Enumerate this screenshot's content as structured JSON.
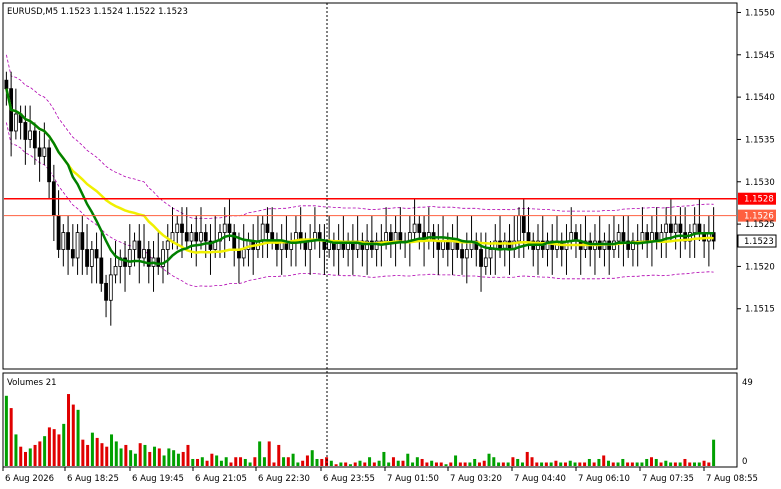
{
  "header": {
    "symbol_line": "EURUSD,M5  1.1523 1.1524 1.1522 1.1523"
  },
  "volume_panel": {
    "label": "Volumes 21",
    "top_tick": "49",
    "bottom_tick": "0"
  },
  "colors": {
    "up_volume": "#00a000",
    "down_volume": "#e00000",
    "ma_fast": "#008000",
    "ma_slow": "#f0f000",
    "envelope": "#b000b0",
    "level_line": "#ff0000",
    "level_line_light": "#ff6040",
    "candle": "#000000",
    "badge_text": "#ffffff",
    "current_badge_text": "#000000"
  },
  "chart_data": {
    "type": "candlestick",
    "symbol": "EURUSD",
    "timeframe": "M5",
    "ohlc_label": {
      "open": 1.1523,
      "high": 1.1524,
      "low": 1.1522,
      "close": 1.1523
    },
    "y_range": [
      1.1508,
      1.1551
    ],
    "y_ticks": [
      "1.1550",
      "1.1545",
      "1.1540",
      "1.1535",
      "1.1530",
      "1.1525",
      "1.1520",
      "1.1515"
    ],
    "x_ticks": [
      "6 Aug 2026",
      "6 Aug 18:25",
      "6 Aug 19:45",
      "6 Aug 21:05",
      "6 Aug 22:30",
      "6 Aug 23:55",
      "7 Aug 01:50",
      "7 Aug 03:20",
      "7 Aug 04:40",
      "7 Aug 06:10",
      "7 Aug 07:35",
      "7 Aug 08:55"
    ],
    "levels": [
      {
        "value": 1.1528,
        "label": "1.1528",
        "style": "solid"
      },
      {
        "value": 1.1526,
        "label": "1.1526",
        "style": "light"
      }
    ],
    "current_price": {
      "value": 1.1523,
      "label": "1.1523"
    },
    "vertical_marker_after_tick": "6 Aug 23:55",
    "closes": [
      1.1541,
      1.1536,
      1.1538,
      1.1537,
      1.1535,
      1.1536,
      1.1534,
      1.1533,
      1.1534,
      1.153,
      1.1526,
      1.1522,
      1.1524,
      1.1522,
      1.1521,
      1.1524,
      1.1522,
      1.152,
      1.1522,
      1.1521,
      1.1518,
      1.1516,
      1.1519,
      1.152,
      1.1521,
      1.152,
      1.1522,
      1.1523,
      1.1521,
      1.1522,
      1.152,
      1.1521,
      1.152,
      1.1522,
      1.1523,
      1.1524,
      1.1525,
      1.1524,
      1.1523,
      1.1524,
      1.1523,
      1.1524,
      1.1523,
      1.1522,
      1.1523,
      1.1524,
      1.1525,
      1.1524,
      1.1522,
      1.1521,
      1.1522,
      1.1523,
      1.1522,
      1.1523,
      1.1525,
      1.1524,
      1.1523,
      1.1522,
      1.1523,
      1.1522,
      1.1523,
      1.1524,
      1.1523,
      1.1522,
      1.1523,
      1.1524,
      1.1523,
      1.1522,
      1.1523,
      1.1522,
      1.1523,
      1.1522,
      1.1523,
      1.1522,
      1.1523,
      1.1522,
      1.1523,
      1.1522,
      1.1523,
      1.1523,
      1.1524,
      1.1523,
      1.1524,
      1.1523,
      1.1523,
      1.1524,
      1.1525,
      1.1524,
      1.1523,
      1.1524,
      1.1523,
      1.1522,
      1.1523,
      1.1522,
      1.1523,
      1.1522,
      1.1521,
      1.1522,
      1.1523,
      1.1522,
      1.152,
      1.1521,
      1.1522,
      1.1523,
      1.1522,
      1.1523,
      1.1522,
      1.1523,
      1.1526,
      1.1524,
      1.1523,
      1.1522,
      1.1523,
      1.1522,
      1.1523,
      1.1522,
      1.1523,
      1.1522,
      1.1523,
      1.1524,
      1.1523,
      1.1522,
      1.1523,
      1.1522,
      1.1523,
      1.1522,
      1.1523,
      1.1522,
      1.1523,
      1.1524,
      1.1523,
      1.1522,
      1.1523,
      1.1523,
      1.1524,
      1.1523,
      1.1524,
      1.1523,
      1.1524,
      1.1525,
      1.1524,
      1.1525,
      1.1524,
      1.1523,
      1.1524,
      1.1525,
      1.1524,
      1.1523,
      1.1524,
      1.1523
    ],
    "volumes": [
      40,
      33,
      18,
      11,
      8,
      10,
      12,
      14,
      17,
      22,
      21,
      18,
      24,
      41,
      35,
      32,
      15,
      12,
      19,
      16,
      13,
      11,
      18,
      14,
      10,
      12,
      9,
      7,
      13,
      12,
      8,
      11,
      10,
      6,
      10,
      9,
      7,
      8,
      12,
      4,
      4,
      5,
      3,
      7,
      6,
      3,
      5,
      2,
      5,
      5,
      4,
      2,
      5,
      14,
      5,
      14,
      2,
      12,
      5,
      5,
      7,
      2,
      3,
      6,
      9,
      4,
      4,
      5,
      3,
      1,
      2,
      2,
      1,
      2,
      3,
      2,
      5,
      2,
      3,
      8,
      2,
      5,
      3,
      3,
      7,
      2,
      5,
      4,
      2,
      3,
      2,
      2,
      1,
      2,
      6,
      2,
      2,
      2,
      4,
      2,
      3,
      7,
      5,
      2,
      2,
      2,
      5,
      4,
      2,
      8,
      5,
      2,
      2,
      2,
      2,
      3,
      2,
      2,
      3,
      2,
      2,
      2,
      4,
      2,
      4,
      6,
      3,
      2,
      2,
      4,
      2,
      2,
      2,
      2,
      4,
      5,
      4,
      2,
      3,
      2,
      2,
      2,
      4,
      2,
      2,
      2,
      3,
      2,
      15
    ]
  }
}
